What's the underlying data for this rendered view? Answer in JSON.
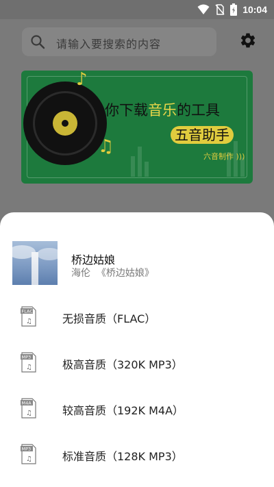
{
  "status_bar": {
    "time": "10:04"
  },
  "search": {
    "placeholder": "请输入要搜索的内容"
  },
  "banner": {
    "title_part1": "你下载",
    "title_highlight": "音乐",
    "title_part2": "的工具",
    "subtitle": "五音助手",
    "maker": "六音制作"
  },
  "song": {
    "title": "桥边姑娘",
    "meta": "海伦  《桥边姑娘》"
  },
  "quality_options": [
    {
      "label": "无损音质（FLAC）",
      "badge": "FLAC"
    },
    {
      "label": "极高音质（320K MP3）",
      "badge": "MP3"
    },
    {
      "label": "较高音质（192K M4A）",
      "badge": "M4A"
    },
    {
      "label": "标准音质（128K MP3）",
      "badge": "MP3"
    }
  ],
  "icons": {
    "search": "search-icon",
    "settings": "gear-icon",
    "wifi": "wifi-icon",
    "no_sim": "no-sim-icon",
    "battery": "battery-icon",
    "file": "audio-file-icon"
  }
}
